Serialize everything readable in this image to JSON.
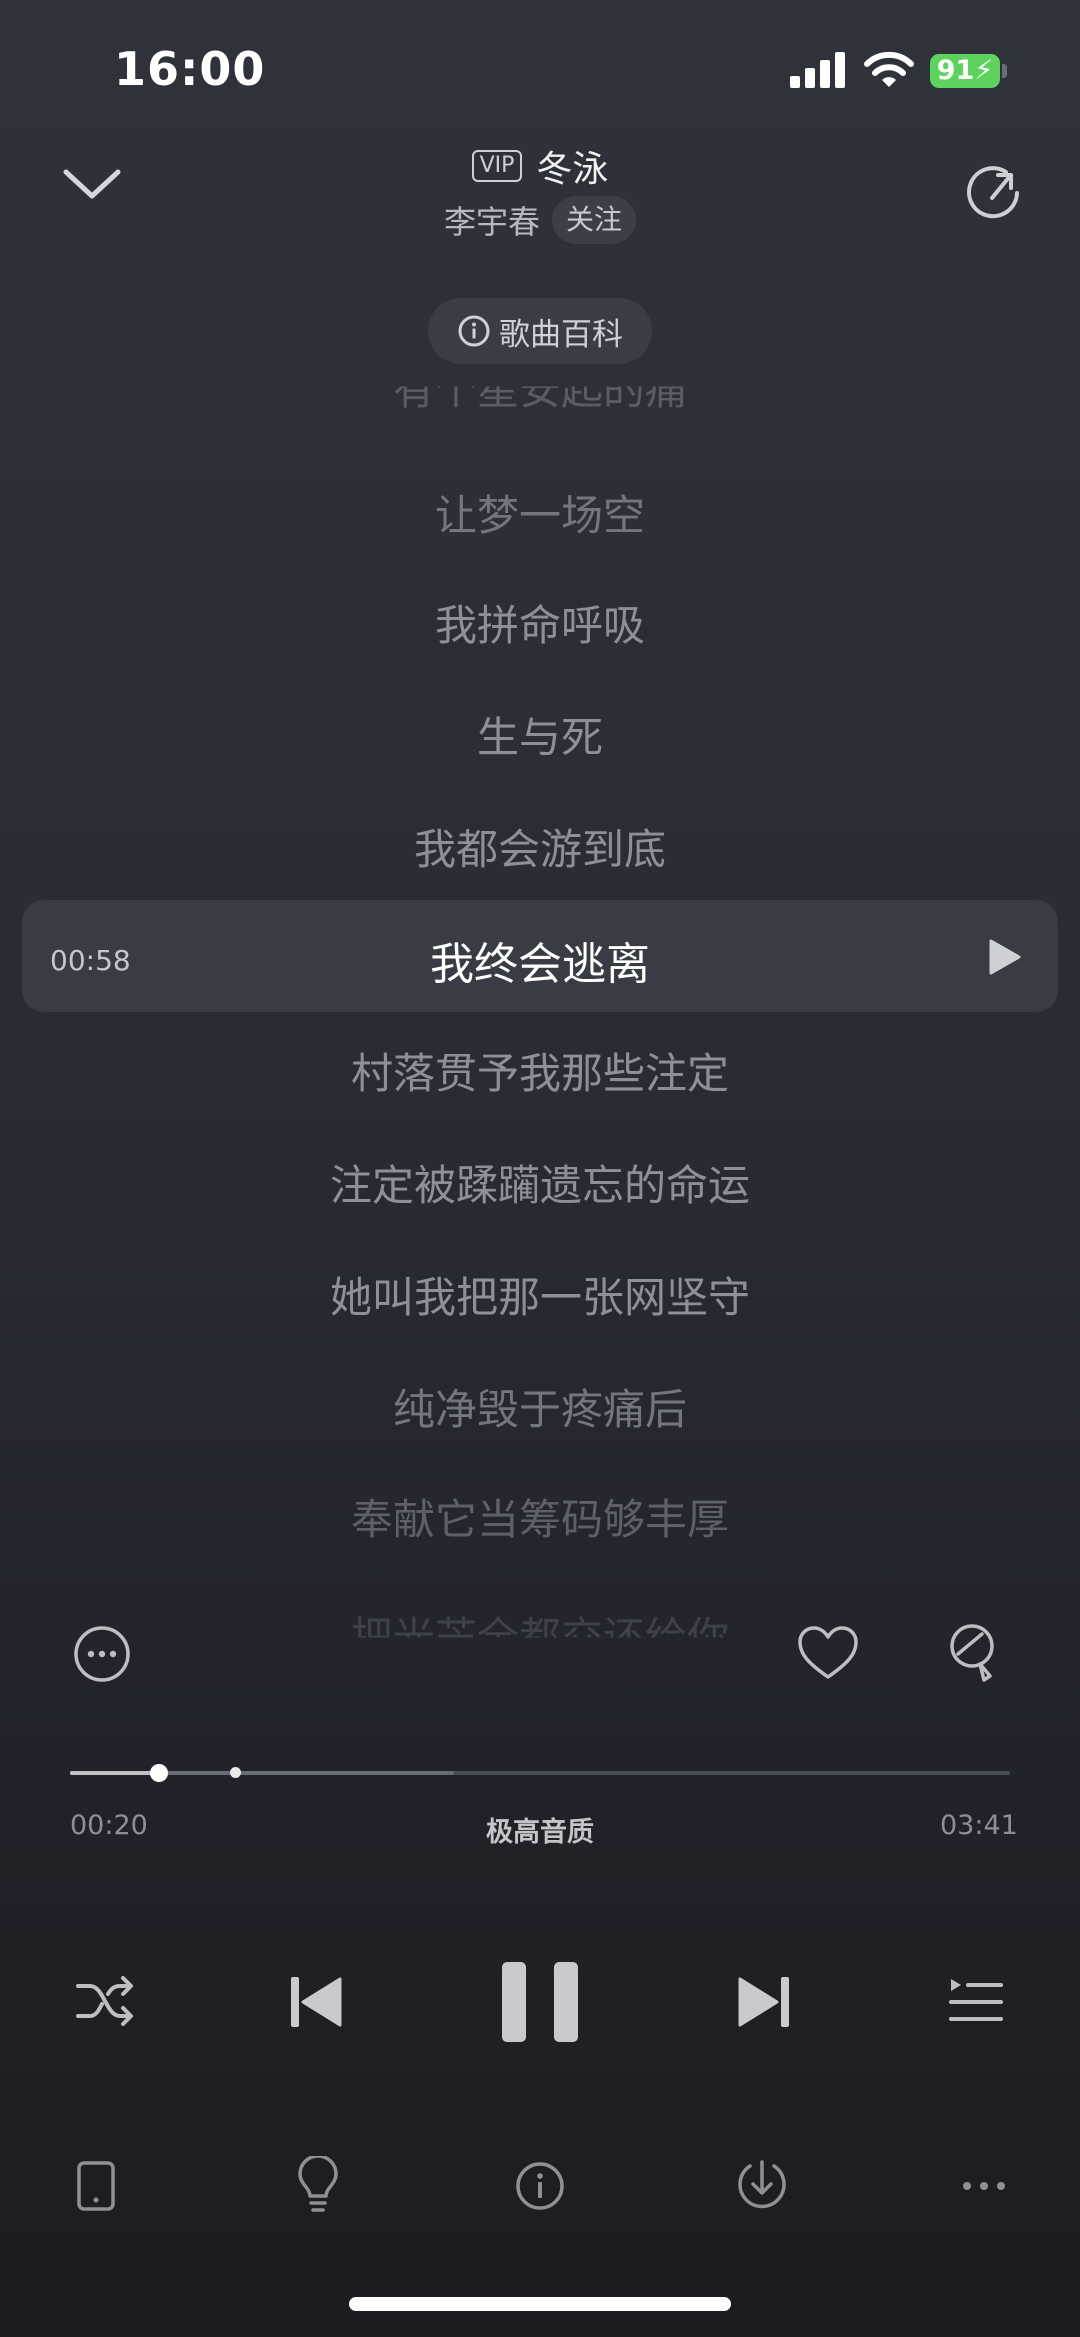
{
  "status_bar": {
    "time": "16:00",
    "battery": "91"
  },
  "header": {
    "vip_badge": "VIP",
    "song_title": "冬泳",
    "artist": "李宇春",
    "follow_label": "关注",
    "wiki_label": "歌曲百科"
  },
  "lyrics": {
    "faded_top": "有个星安起的痛",
    "before": [
      "让梦一场空",
      "我拼命呼吸",
      "生与死",
      "我都会游到底"
    ],
    "current_time": "00:58",
    "current": "我终会逃离",
    "after": [
      "村落贯予我那些注定",
      "注定被蹂躏遗忘的命运",
      "她叫我把那一张网坚守",
      "纯净毁于疼痛后"
    ],
    "faded_bottom": "奉献它当筹码够丰厚",
    "faded_tail": "把光芒全都交还给你"
  },
  "player": {
    "elapsed": "00:20",
    "total": "03:41",
    "quality": "极高音质",
    "progress_played": 0.095,
    "progress_buffered": 0.409,
    "climax_marker": 0.175
  },
  "icons": {
    "collapse": "chevron-down-icon",
    "share": "share-icon",
    "more_actions": "more-circle-icon",
    "like": "heart-icon",
    "comment": "comment-icon",
    "shuffle": "shuffle-icon",
    "previous": "skip-previous-icon",
    "pause": "pause-icon",
    "next": "skip-next-icon",
    "playlist": "playlist-icon",
    "device": "phone-device-icon",
    "tips": "lightbulb-icon",
    "info": "info-icon",
    "download": "download-icon",
    "more": "more-dots-icon"
  }
}
